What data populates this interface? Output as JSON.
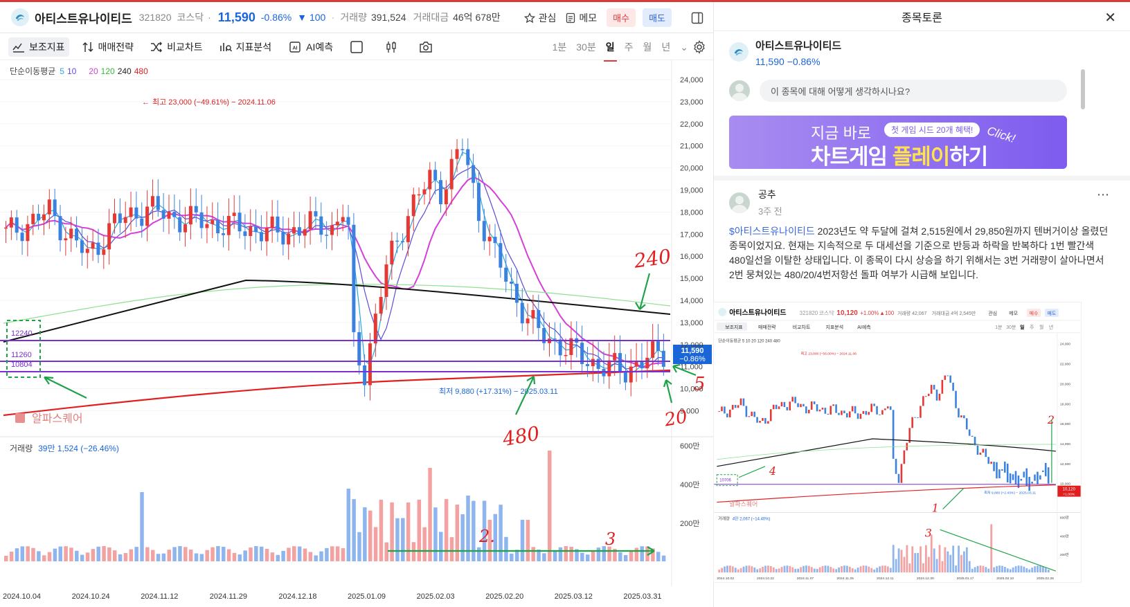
{
  "header": {
    "name": "아티스트유나이티드",
    "code": "321820",
    "market": "코스닥",
    "price": "11,590",
    "change_pct": "-0.86%",
    "change_abs": "▼ 100",
    "volume_label": "거래량",
    "volume": "391,524",
    "amount_label": "거래대금",
    "amount": "46억 678만",
    "watch": "관심",
    "memo": "메모",
    "buy": "매수",
    "sell": "매도"
  },
  "toolbar": {
    "items": [
      "보조지표",
      "매매전략",
      "비교차트",
      "지표분석",
      "AI예측"
    ],
    "periods": [
      "1분",
      "30분",
      "일",
      "주",
      "월",
      "년"
    ],
    "active_period": "일"
  },
  "chart": {
    "ma_label": "단순이동평균",
    "ma_periods": [
      "5",
      "10",
      "20",
      "120",
      "240",
      "480"
    ],
    "high_annotation": "최고 23,000 (−49.61%) − 2024.11.06",
    "low_annotation": "최저 9,880 (+17.31%) − 2025.03.11",
    "price_tag_value": "11,590",
    "price_tag_pct": "−0.86%",
    "box_labels": [
      "12240",
      "11260",
      "10804"
    ],
    "watermark": "알파스퀘어",
    "volume_label": "거래량",
    "volume_value": "39만 1,524 (−26.46%)",
    "handwriting": [
      "240",
      "480",
      "5",
      "20",
      "2.",
      "3"
    ],
    "price_axis": [
      "24,000",
      "23,000",
      "22,000",
      "21,000",
      "20,000",
      "19,000",
      "18,000",
      "17,000",
      "16,000",
      "15,000",
      "14,000",
      "13,000",
      "12,000",
      "11,000",
      "10,000",
      "9,000"
    ],
    "volume_axis": [
      "600만",
      "400만",
      "200만"
    ],
    "dates": [
      "2024.10.04",
      "2024.10.24",
      "2024.11.12",
      "2024.11.29",
      "2024.12.18",
      "2025.01.09",
      "2025.02.03",
      "2025.02.20",
      "2025.03.12",
      "2025.03.31"
    ]
  },
  "panel": {
    "title": "종목토론",
    "stock_name": "아티스트유나이티드",
    "stock_price": "11,590 −0.86%",
    "comment_placeholder": "이 종목에 대해 어떻게 생각하시나요?",
    "banner_line1": "지금 바로",
    "banner_line2a": "차트게임 ",
    "banner_line2b": "플레이",
    "banner_line2c": "하기",
    "banner_tag": "첫 게임 시드 20개 혜택!",
    "banner_click": "Click!",
    "post_author": "공추",
    "post_time": "3주 전",
    "post_ticker": "$아티스트유나이티드",
    "post_text": " 2023년도 약 두달에 걸쳐 2,515원에서 29,850원까지  텐버거이상 올렸던  종목이었지요. 현재는 지속적으로 두 대세선을 기준으로 반등과 하락을 반복하다 1번 빨간색 480일선을 이탈한 상태입니다. 이 종목이 다시 상승을 하기 위해서는  3번 거래량이 살아나면서  2번 뭉쳐있는 480/20/4번저항선 돌파 여부가 시급해 보입니다."
  },
  "thumb": {
    "name": "아티스트유나이티드",
    "code": "321820",
    "market": "코스닥",
    "price": "10,120",
    "change": "+1.00%",
    "change_abs": "▲100",
    "volume": "거래량 42,067",
    "amount": "거래대금 4억 2,545만",
    "watch": "관심",
    "memo": "메모",
    "buy": "매수",
    "sell": "매도",
    "toolbar": [
      "보조지표",
      "매매전략",
      "비교차트",
      "지표분석",
      "AI예측"
    ],
    "periods": [
      "1분",
      "30분",
      "일",
      "주",
      "월",
      "년"
    ],
    "ma_label": "단순이동평균 5 10 20 120 240 480",
    "high_annotation": "최고 23,000 (−56.00%) − 2024.11.06",
    "low_annotation": "최저 9,880 (+2.43%) − 2025.03.11",
    "price_tag": "10,120",
    "price_tag_pct": "+1.00%",
    "box_label": "10706",
    "watermark": "알파스퀘어",
    "volume_label": "거래량",
    "volume_value": "4만 2,067 (−14.40%)",
    "price_axis": [
      "24,000",
      "22,000",
      "20,000",
      "18,000",
      "16,000",
      "14,000",
      "12,000",
      "10,000"
    ],
    "volume_axis": [
      "600만",
      "400만",
      "200만"
    ],
    "dates": [
      "2024.10.02",
      "2024.10.22",
      "2024.11.07",
      "2024.11.25",
      "2024.12.11",
      "2024.12.30",
      "2025.01.17",
      "2025.02.10",
      "2025.02.26"
    ],
    "handwriting": [
      "2",
      "4",
      "1",
      "3"
    ]
  }
}
